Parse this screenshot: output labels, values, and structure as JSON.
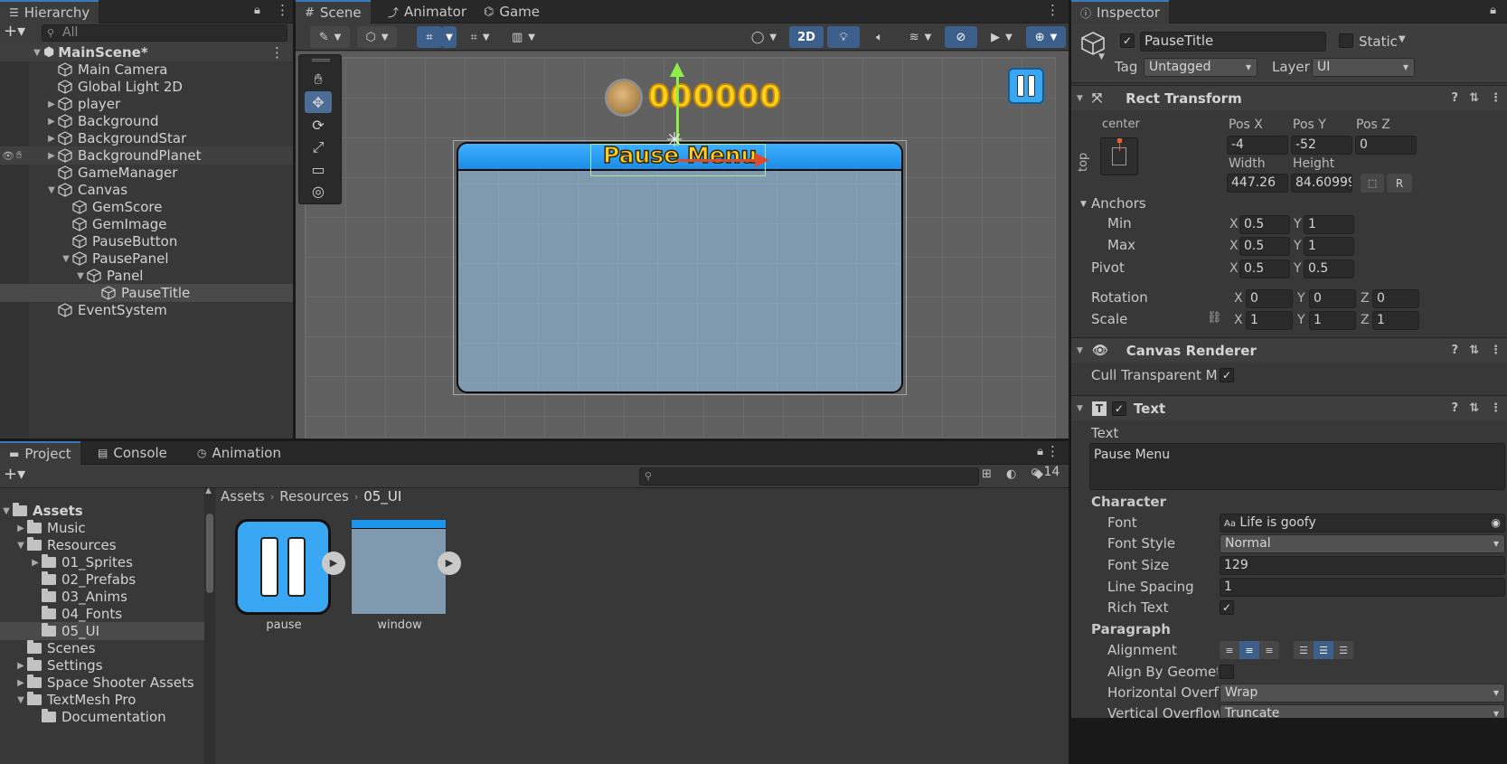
{
  "hierarchy": {
    "tab": "Hierarchy",
    "search_placeholder": "All",
    "scene": "MainScene*",
    "items": [
      {
        "label": "Main Camera"
      },
      {
        "label": "Global Light 2D"
      },
      {
        "label": "player"
      },
      {
        "label": "Background"
      },
      {
        "label": "BackgroundStar"
      },
      {
        "label": "BackgroundPlanet"
      },
      {
        "label": "GameManager"
      },
      {
        "label": "Canvas"
      },
      {
        "label": "GemScore"
      },
      {
        "label": "GemImage"
      },
      {
        "label": "PauseButton"
      },
      {
        "label": "PausePanel"
      },
      {
        "label": "Panel"
      },
      {
        "label": "PauseTitle"
      },
      {
        "label": "EventSystem"
      }
    ]
  },
  "scene_view": {
    "tabs": [
      "Scene",
      "Animator",
      "Game"
    ],
    "toggle_2d": "2D",
    "score": "000000",
    "panel_title": "Pause Menu"
  },
  "inspector": {
    "tab": "Inspector",
    "object_name": "PauseTitle",
    "static_label": "Static",
    "tag_label": "Tag",
    "tag_value": "Untagged",
    "layer_label": "Layer",
    "layer_value": "UI",
    "rect_transform": {
      "title": "Rect Transform",
      "anchor_h": "center",
      "anchor_v": "top",
      "pos_x_label": "Pos X",
      "pos_x": "-4",
      "pos_y_label": "Pos Y",
      "pos_y": "-52",
      "pos_z_label": "Pos Z",
      "pos_z": "0",
      "width_label": "Width",
      "width": "447.26",
      "height_label": "Height",
      "height": "84.60999",
      "r_label": "R",
      "anchors_label": "Anchors",
      "min_label": "Min",
      "min_x": "0.5",
      "min_y": "1",
      "max_label": "Max",
      "max_x": "0.5",
      "max_y": "1",
      "pivot_label": "Pivot",
      "pivot_x": "0.5",
      "pivot_y": "0.5",
      "rotation_label": "Rotation",
      "rot_x": "0",
      "rot_y": "0",
      "rot_z": "0",
      "scale_label": "Scale",
      "scale_x": "1",
      "scale_y": "1",
      "scale_z": "1",
      "x": "X",
      "y": "Y",
      "z": "Z"
    },
    "canvas_renderer": {
      "title": "Canvas Renderer",
      "cull_label": "Cull Transparent Mes"
    },
    "text": {
      "title": "Text",
      "text_label": "Text",
      "text_value": "Pause Menu",
      "character_label": "Character",
      "font_label": "Font",
      "font_value": "Life is goofy",
      "font_style_label": "Font Style",
      "font_style_value": "Normal",
      "font_size_label": "Font Size",
      "font_size_value": "129",
      "line_spacing_label": "Line Spacing",
      "line_spacing_value": "1",
      "rich_text_label": "Rich Text",
      "paragraph_label": "Paragraph",
      "alignment_label": "Alignment",
      "align_geom_label": "Align By Geometry",
      "h_overflow_label": "Horizontal Overflo",
      "h_overflow_value": "Wrap",
      "v_overflow_label": "Vertical Overflow",
      "v_overflow_value": "Truncate"
    }
  },
  "project": {
    "tabs": [
      "Project",
      "Console",
      "Animation"
    ],
    "hidden_count": "14",
    "breadcrumb": [
      "Assets",
      "Resources",
      "05_UI"
    ],
    "tree": [
      {
        "label": "Assets"
      },
      {
        "label": "Music"
      },
      {
        "label": "Resources"
      },
      {
        "label": "01_Sprites"
      },
      {
        "label": "02_Prefabs"
      },
      {
        "label": "03_Anims"
      },
      {
        "label": "04_Fonts"
      },
      {
        "label": "05_UI"
      },
      {
        "label": "Scenes"
      },
      {
        "label": "Settings"
      },
      {
        "label": "Space Shooter Assets"
      },
      {
        "label": "TextMesh Pro"
      },
      {
        "label": "Documentation"
      }
    ],
    "assets": [
      {
        "label": "pause"
      },
      {
        "label": "window"
      }
    ]
  },
  "colors": {
    "accent": "#3a79bb",
    "panel_blue": "#1a95ee",
    "panel_body": "#7f9aae",
    "title_yellow": "#ffd21f"
  }
}
